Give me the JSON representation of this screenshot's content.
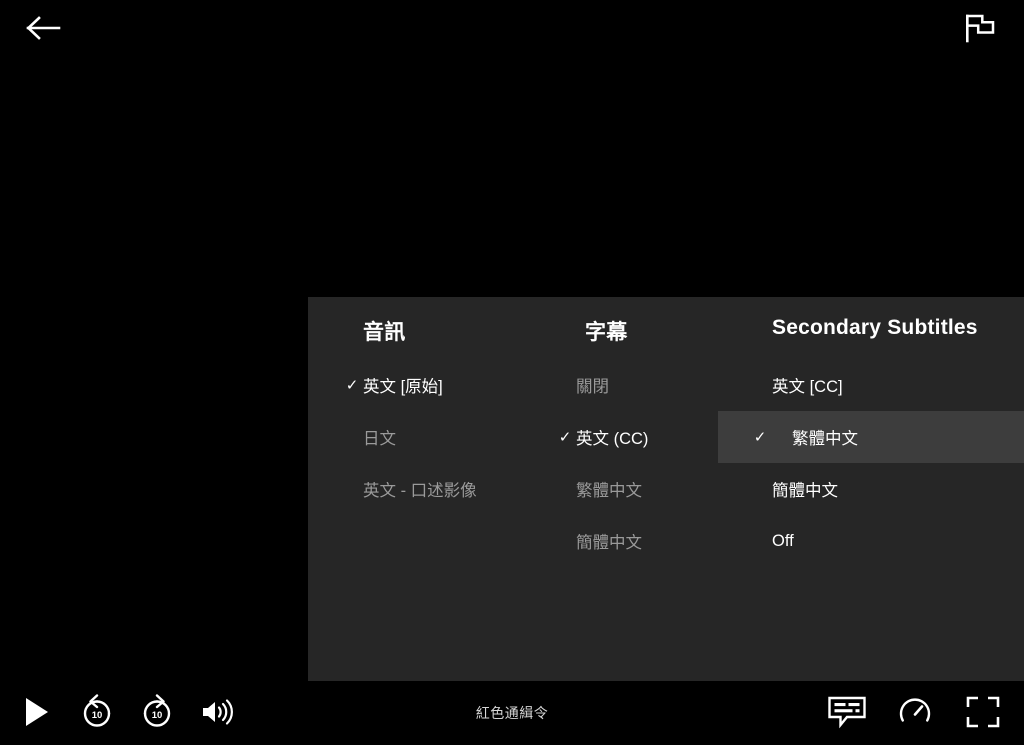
{
  "player": {
    "title": "紅色通緝令",
    "background_color": "#000000",
    "panel_color": "#262626",
    "highlight_color": "#3d3d3d"
  },
  "topbar": {
    "back_label": "back-arrow",
    "flag_label": "flag"
  },
  "settings": {
    "columns": [
      {
        "id": "audio",
        "header": "音訊",
        "options": [
          {
            "label": "英文 [原始]",
            "selected": true,
            "highlighted": false
          },
          {
            "label": "日文",
            "selected": false,
            "highlighted": false
          },
          {
            "label": "英文 - 口述影像",
            "selected": false,
            "highlighted": false
          }
        ]
      },
      {
        "id": "subtitles",
        "header": "字幕",
        "options": [
          {
            "label": "關閉",
            "selected": false,
            "highlighted": false
          },
          {
            "label": "英文 (CC)",
            "selected": true,
            "highlighted": false
          },
          {
            "label": "繁體中文",
            "selected": false,
            "highlighted": false
          },
          {
            "label": "簡體中文",
            "selected": false,
            "highlighted": false
          }
        ]
      },
      {
        "id": "secondary-subtitles",
        "header": "Secondary Subtitles",
        "options": [
          {
            "label": "英文 [CC]",
            "selected": false,
            "highlighted": false,
            "bright": true
          },
          {
            "label": "繁體中文",
            "selected": true,
            "highlighted": true,
            "bright": true
          },
          {
            "label": "簡體中文",
            "selected": false,
            "highlighted": false,
            "bright": true
          },
          {
            "label": "Off",
            "selected": false,
            "highlighted": false,
            "bright": true
          }
        ]
      }
    ],
    "checkmark": "✓"
  },
  "controls": {
    "play_label": "play",
    "rewind_label": "rewind-10",
    "rewind_seconds": "10",
    "forward_label": "forward-10",
    "forward_seconds": "10",
    "volume_label": "volume",
    "subtitles_label": "subtitles",
    "speed_label": "playback-speed",
    "fullscreen_label": "fullscreen"
  }
}
